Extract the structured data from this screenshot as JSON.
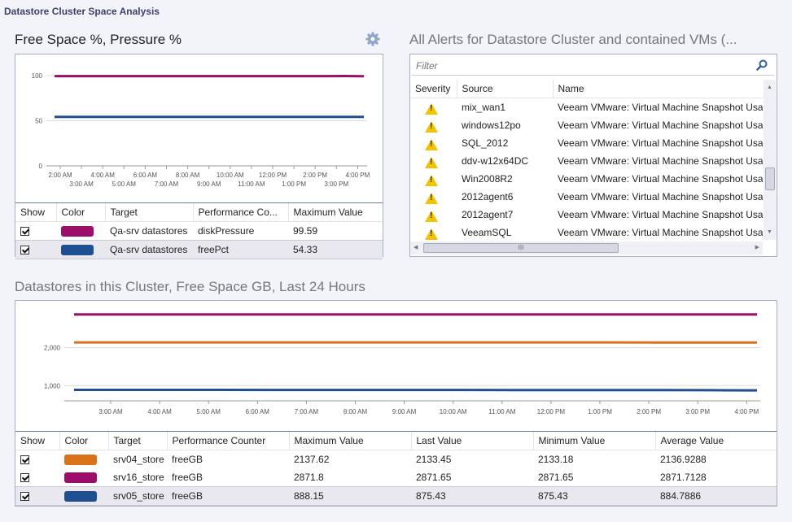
{
  "page": {
    "title": "Datastore Cluster Space Analysis"
  },
  "pressure_panel": {
    "title": "Free Space %, Pressure %",
    "settings_icon": "gear-icon",
    "legend_headers": [
      "Show",
      "Color",
      "Target",
      "Performance Co...",
      "Maximum Value"
    ],
    "legend_rows": [
      {
        "target": "Qa-srv datastores",
        "counter": "diskPressure",
        "max": "99.59",
        "color": "#9b0f6a"
      },
      {
        "target": "Qa-srv datastores",
        "counter": "freePct",
        "max": "54.33",
        "color": "#1f4e91"
      }
    ]
  },
  "alerts_panel": {
    "title": "All Alerts for Datastore Cluster and contained VMs (...",
    "filter_placeholder": "Filter",
    "search_icon": "search-icon",
    "columns": [
      "Severity",
      "Source",
      "Name"
    ],
    "rows": [
      {
        "severity": "warning",
        "source": "mix_wan1",
        "name": "Veeam VMware: Virtual Machine Snapshot Usag"
      },
      {
        "severity": "warning",
        "source": "windows12po",
        "name": "Veeam VMware: Virtual Machine Snapshot Usag"
      },
      {
        "severity": "warning",
        "source": "SQL_2012",
        "name": "Veeam VMware: Virtual Machine Snapshot Usag"
      },
      {
        "severity": "warning",
        "source": "ddv-w12x64DC",
        "name": "Veeam VMware: Virtual Machine Snapshot Usag"
      },
      {
        "severity": "warning",
        "source": "Win2008R2",
        "name": "Veeam VMware: Virtual Machine Snapshot Usag"
      },
      {
        "severity": "warning",
        "source": "2012agent6",
        "name": "Veeam VMware: Virtual Machine Snapshot Usag"
      },
      {
        "severity": "warning",
        "source": "2012agent7",
        "name": "Veeam VMware: Virtual Machine Snapshot Usag"
      },
      {
        "severity": "warning",
        "source": "VeeamSQL",
        "name": "Veeam VMware: Virtual Machine Snapshot Usag"
      }
    ],
    "hscroll_grip": "III"
  },
  "datastores_panel": {
    "title": "Datastores in this Cluster, Free Space GB, Last 24 Hours",
    "legend_headers": [
      "Show",
      "Color",
      "Target",
      "Performance Counter",
      "Maximum Value",
      "Last Value",
      "Minimum Value",
      "Average Value"
    ],
    "legend_rows": [
      {
        "target": "srv04_store",
        "counter": "freeGB",
        "max": "2137.62",
        "last": "2133.45",
        "min": "2133.18",
        "avg": "2136.9288",
        "color": "#d9731a"
      },
      {
        "target": "srv16_store",
        "counter": "freeGB",
        "max": "2871.8",
        "last": "2871.65",
        "min": "2871.65",
        "avg": "2871.7128",
        "color": "#9b0f6a"
      },
      {
        "target": "srv05_store",
        "counter": "freeGB",
        "max": "888.15",
        "last": "875.43",
        "min": "875.43",
        "avg": "884.7886",
        "color": "#1f4e91"
      }
    ]
  },
  "chart_data": [
    {
      "type": "line",
      "title": "Free Space %, Pressure %",
      "ylim": [
        0,
        100
      ],
      "yticks": [
        0,
        50,
        100
      ],
      "xticks_upper": [
        "2:00 AM",
        "4:00 AM",
        "6:00 AM",
        "8:00 AM",
        "10:00 AM",
        "12:00 PM",
        "2:00 PM",
        "4:00 PM"
      ],
      "xticks_lower": [
        "3:00 AM",
        "5:00 AM",
        "7:00 AM",
        "9:00 AM",
        "11:00 AM",
        "1:00 PM",
        "3:00 PM"
      ],
      "series": [
        {
          "name": "diskPressure",
          "color": "#9b0f6a",
          "values": [
            99.5,
            99.5,
            99.5,
            99.5,
            99.5,
            99.5,
            99.5,
            99.5,
            99.5,
            99.5,
            99.5,
            99.5,
            99.5,
            99.5,
            99.5,
            99.59,
            99.4
          ]
        },
        {
          "name": "freePct",
          "color": "#1f4e91",
          "values": [
            54.3,
            54.3,
            54.3,
            54.3,
            54.3,
            54.3,
            54.3,
            54.3,
            54.3,
            54.3,
            54.3,
            54.3,
            54.3,
            54.3,
            54.3,
            54.3,
            54.3
          ]
        }
      ]
    },
    {
      "type": "line",
      "title": "Datastores in this Cluster, Free Space GB, Last 24 Hours",
      "ylim": [
        600,
        3100
      ],
      "yticks": [
        1000,
        2000
      ],
      "ytick_labels": [
        "1,000",
        "2,000"
      ],
      "xticks": [
        "3:00 AM",
        "4:00 AM",
        "5:00 AM",
        "6:00 AM",
        "7:00 AM",
        "8:00 AM",
        "9:00 AM",
        "10:00 AM",
        "11:00 AM",
        "12:00 PM",
        "1:00 PM",
        "2:00 PM",
        "3:00 PM",
        "4:00 PM"
      ],
      "series": [
        {
          "name": "srv16_store",
          "color": "#9b0f6a",
          "values": [
            2871.7,
            2871.7,
            2871.7,
            2871.7,
            2871.7,
            2871.7,
            2871.7,
            2871.7,
            2871.7,
            2871.7,
            2871.7,
            2871.7,
            2871.7,
            2871.7,
            2871.65
          ]
        },
        {
          "name": "srv04_store",
          "color": "#d9731a",
          "values": [
            2137,
            2137,
            2137,
            2137,
            2137,
            2137,
            2137,
            2137,
            2137,
            2137,
            2137,
            2136,
            2135,
            2134,
            2133.45
          ]
        },
        {
          "name": "srv05_store",
          "color": "#1f4e91",
          "values": [
            888,
            888,
            888,
            888,
            887,
            887,
            887,
            886,
            886,
            885,
            885,
            884,
            883,
            880,
            875.43
          ]
        }
      ]
    }
  ]
}
